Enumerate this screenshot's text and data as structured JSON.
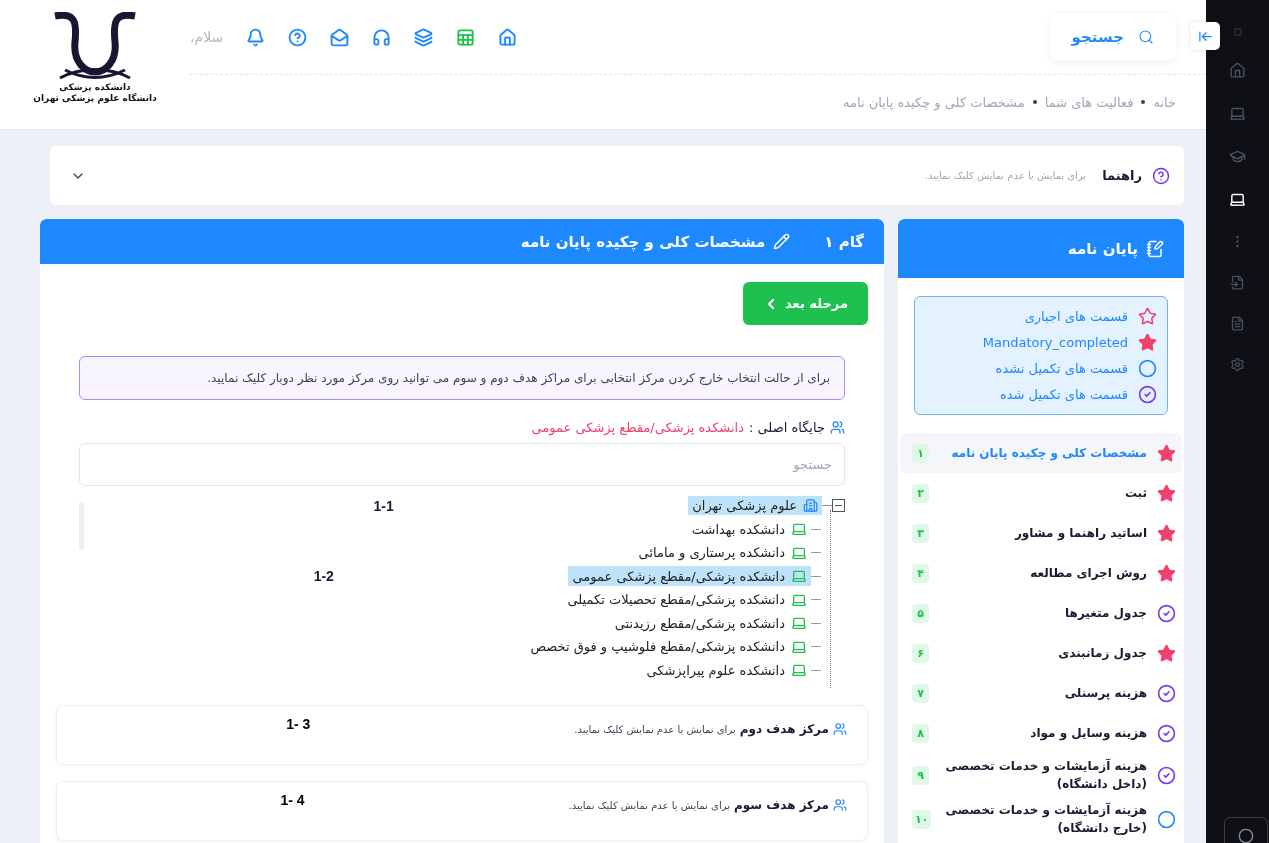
{
  "header": {
    "search_label": "جستجو",
    "greeting": "سلام،",
    "logo_lines": [
      "دانشکده پزشکی",
      "دانشگاه علوم پزشکی تهران"
    ]
  },
  "breadcrumb": [
    "خانه",
    "فعالیت های شما",
    "مشخصات کلی و چکیده پایان نامه"
  ],
  "guide": {
    "title": "راهنما",
    "hint": "برای نمایش یا عدم نمایش کلیک نمایید."
  },
  "step_panel": {
    "step": "گام ۱",
    "title": "مشخصات کلی و چکیده پایان نامه",
    "next_button": "مرحله بعد",
    "notice": "برای از حالت انتخاب خارج کردن مرکز انتخابی برای مراکز هدف دوم و سوم می توانید روی مرکز مورد نظر دوبار کلیک نمایید.",
    "main_location_label": "جایگاه اصلی :",
    "main_location_value": "دانشکده پزشکی/مقطع پزشکی عمومی",
    "search_placeholder": "جستجو",
    "tree": {
      "label": "علوم پزشکی تهران",
      "selected": true,
      "expanded": true,
      "note": "1-1",
      "children": [
        {
          "label": "دانشکده بهداشت",
          "selected": false
        },
        {
          "label": "دانشکده پرستاری و مامائی",
          "selected": false
        },
        {
          "label": "دانشکده پزشکی/مقطع پزشکی عمومی",
          "selected": true,
          "note": "1-2"
        },
        {
          "label": "دانشکده پزشکی/مقطع تحصیلات تکمیلی",
          "selected": false
        },
        {
          "label": "دانشکده پزشکی/مقطع رزیدنتی",
          "selected": false
        },
        {
          "label": "دانشکده پزشکی/مقطع فلوشیپ و فوق تخصص",
          "selected": false
        },
        {
          "label": "دانشکده علوم پیراپزشکی",
          "selected": false
        }
      ]
    }
  },
  "target_centers": [
    {
      "title": "مرکز هدف دوم",
      "hint": "برای نمایش یا عدم نمایش کلیک نمایید.",
      "note": "1- 3"
    },
    {
      "title": "مرکز هدف سوم",
      "hint": "برای نمایش یا عدم نمایش کلیک نمایید.",
      "note": "1- 4"
    }
  ],
  "thesis_panel": {
    "title": "پایان نامه",
    "legend": [
      {
        "kind": "star_outline",
        "label": "قسمت های اجباری"
      },
      {
        "kind": "star",
        "label": "Mandatory_completed"
      },
      {
        "kind": "circle",
        "label": "قسمت های تکمیل نشده"
      },
      {
        "kind": "check",
        "label": "قسمت های تکمیل شده"
      }
    ],
    "steps": [
      {
        "kind": "star",
        "label": "مشخصات کلی و چکیده پایان نامه",
        "number": "۱",
        "selected": true
      },
      {
        "kind": "star",
        "label": "ثبت",
        "number": "۲",
        "selected": false
      },
      {
        "kind": "star",
        "label": "اساتید راهنما و مشاور",
        "number": "۳",
        "selected": false
      },
      {
        "kind": "star",
        "label": "روش اجرای مطالعه",
        "number": "۴",
        "selected": false
      },
      {
        "kind": "check",
        "label": "جدول متغیرها",
        "number": "۵",
        "selected": false
      },
      {
        "kind": "star",
        "label": "جدول زمانبندی",
        "number": "۶",
        "selected": false
      },
      {
        "kind": "check",
        "label": "هزینه پرسنلی",
        "number": "۷",
        "selected": false
      },
      {
        "kind": "check",
        "label": "هزینه وسایل و مواد",
        "number": "۸",
        "selected": false
      },
      {
        "kind": "check",
        "label": "هزینه آزمایشات و خدمات تخصصی (داخل دانشگاه)",
        "number": "۹",
        "selected": false
      },
      {
        "kind": "circle",
        "label": "هزینه آزمایشات و خدمات تخصصی (خارج دانشگاه)",
        "number": "۱۰",
        "selected": false
      }
    ]
  }
}
